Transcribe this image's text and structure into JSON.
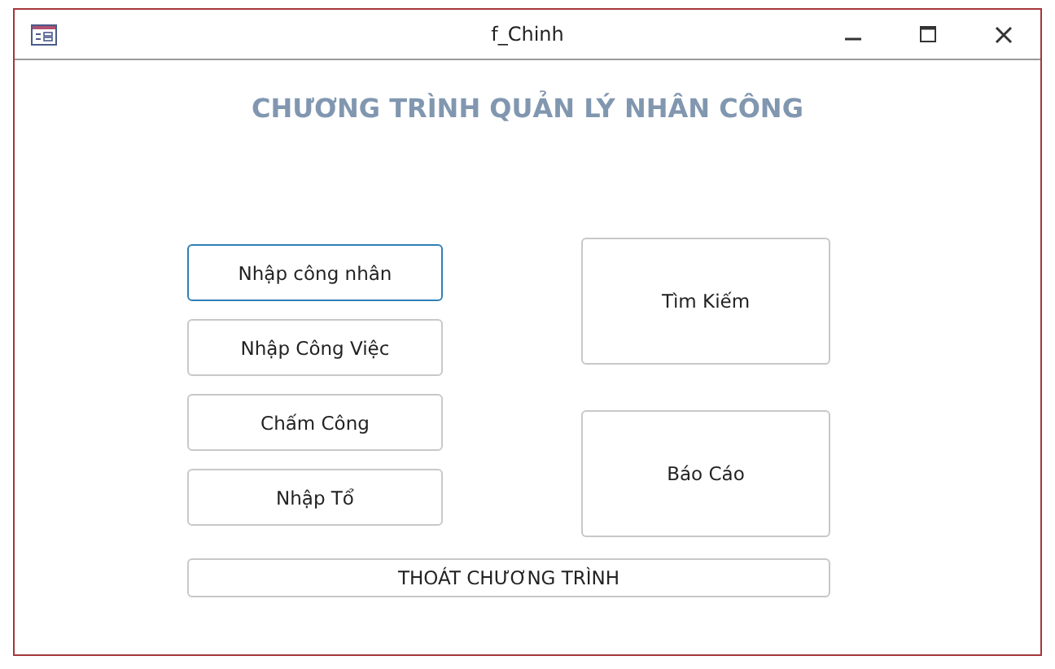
{
  "window": {
    "title": "f_Chinh"
  },
  "heading": "CHƯƠNG TRÌNH QUẢN LÝ NHÂN CÔNG",
  "left_buttons": [
    {
      "label": "Nhập công nhân",
      "focused": true
    },
    {
      "label": "Nhập Công Việc",
      "focused": false
    },
    {
      "label": "Chấm Công",
      "focused": false
    },
    {
      "label": "Nhập Tổ",
      "focused": false
    }
  ],
  "right_buttons": [
    {
      "label": "Tìm Kiếm",
      "focused": false
    },
    {
      "label": "Báo Cáo",
      "focused": false
    }
  ],
  "exit_button": {
    "label": "THOÁT CHƯƠNG TRÌNH",
    "focused": false
  }
}
